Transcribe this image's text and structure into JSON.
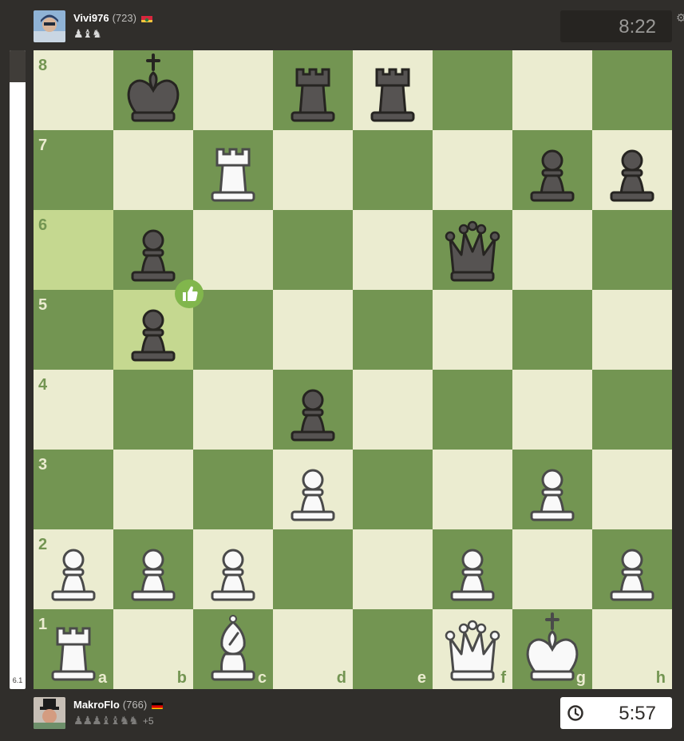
{
  "top_player": {
    "name": "Vivi976",
    "rating": "(723)",
    "captured": "♟♝♞",
    "clock": "8:22"
  },
  "bottom_player": {
    "name": "MakroFlo",
    "rating": "(766)",
    "captured": "♟♟♟♝♝♞♞",
    "advantage": "+5",
    "clock": "5:57"
  },
  "eval_bar": {
    "value": "6.1",
    "black_share": 0.05
  },
  "board": {
    "ranks": [
      "8",
      "7",
      "6",
      "5",
      "4",
      "3",
      "2",
      "1"
    ],
    "files": [
      "a",
      "b",
      "c",
      "d",
      "e",
      "f",
      "g",
      "h"
    ],
    "light_color": "#ebecd0",
    "dark_color": "#739552",
    "highlight_color": "#c5d890",
    "highlighted_squares": [
      "a6",
      "b5"
    ],
    "move_badge": {
      "square": "b5",
      "icon": "thumbs-up-icon",
      "color": "#81b64c"
    },
    "pieces": [
      {
        "square": "b8",
        "type": "king",
        "color": "black"
      },
      {
        "square": "d8",
        "type": "rook",
        "color": "black"
      },
      {
        "square": "e8",
        "type": "rook",
        "color": "black"
      },
      {
        "square": "c7",
        "type": "rook",
        "color": "white"
      },
      {
        "square": "g7",
        "type": "pawn",
        "color": "black"
      },
      {
        "square": "h7",
        "type": "pawn",
        "color": "black"
      },
      {
        "square": "b6",
        "type": "pawn",
        "color": "black"
      },
      {
        "square": "f6",
        "type": "queen",
        "color": "black"
      },
      {
        "square": "b5",
        "type": "pawn",
        "color": "black"
      },
      {
        "square": "d4",
        "type": "pawn",
        "color": "black"
      },
      {
        "square": "d3",
        "type": "pawn",
        "color": "white"
      },
      {
        "square": "g3",
        "type": "pawn",
        "color": "white"
      },
      {
        "square": "a2",
        "type": "pawn",
        "color": "white"
      },
      {
        "square": "b2",
        "type": "pawn",
        "color": "white"
      },
      {
        "square": "c2",
        "type": "pawn",
        "color": "white"
      },
      {
        "square": "f2",
        "type": "pawn",
        "color": "white"
      },
      {
        "square": "h2",
        "type": "pawn",
        "color": "white"
      },
      {
        "square": "a1",
        "type": "rook",
        "color": "white"
      },
      {
        "square": "c1",
        "type": "bishop",
        "color": "white"
      },
      {
        "square": "f1",
        "type": "queen",
        "color": "white"
      },
      {
        "square": "g1",
        "type": "king",
        "color": "white"
      }
    ]
  }
}
